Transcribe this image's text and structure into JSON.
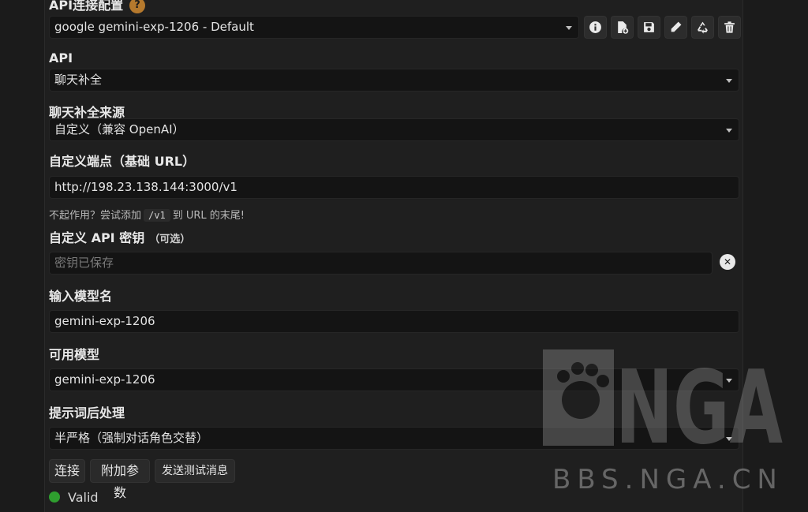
{
  "profile": {
    "heading": "API连接配置",
    "help_icon": "?",
    "selected": "google gemini-exp-1206 - Default"
  },
  "api": {
    "label": "API",
    "selected": "聊天补全"
  },
  "source": {
    "label": "聊天补全来源",
    "selected": "自定义（兼容 OpenAI）"
  },
  "endpoint": {
    "label": "自定义端点（基础 URL）",
    "value": "http://198.23.138.144:3000/v1",
    "hint_before": "不起作用？尝试添加",
    "hint_code": "/v1",
    "hint_after": "到 URL 的末尾!"
  },
  "api_key": {
    "label": "自定义 API 密钥",
    "optional": "（可选）",
    "placeholder": "密钥已保存",
    "clear_icon": "✕"
  },
  "model_name": {
    "label": "输入模型名",
    "value": "gemini-exp-1206"
  },
  "available_models": {
    "label": "可用模型",
    "selected": "gemini-exp-1206"
  },
  "post_processing": {
    "label": "提示词后处理",
    "selected": "半严格（强制对话角色交替）"
  },
  "actions": {
    "connect": "连接",
    "extra_params": "附加参数",
    "send_test": "发送测试消息"
  },
  "status": {
    "text": "Valid",
    "color": "#2f9e2f"
  },
  "watermark": {
    "logo": "NGA",
    "site": "BBS.NGA.CN"
  }
}
